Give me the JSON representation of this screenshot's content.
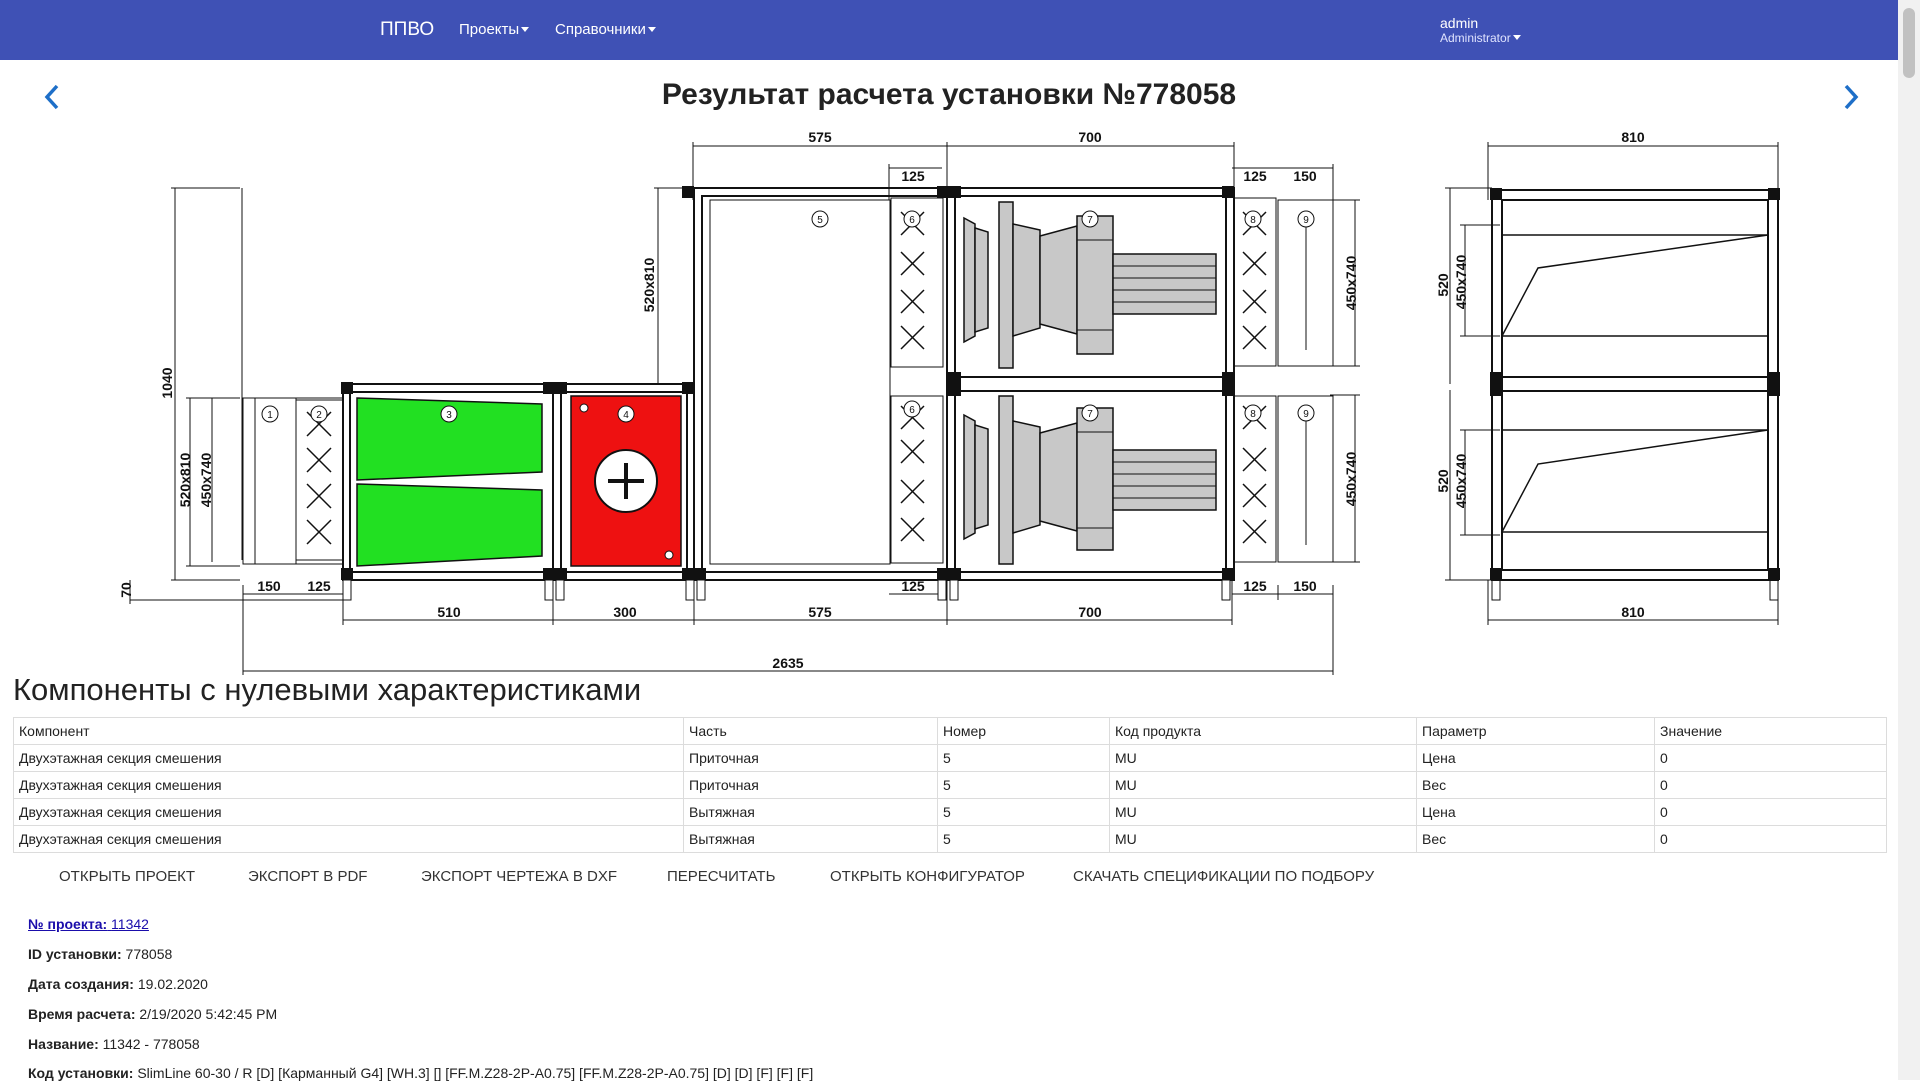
{
  "navbar": {
    "brand": "ППВО",
    "projects": "Проекты",
    "references": "Справочники",
    "user_name": "admin",
    "user_role": "Administrator",
    "color": "#3f51b5"
  },
  "page": {
    "title": "Результат расчета установки №778058"
  },
  "drawing": {
    "dims": {
      "top_575": "575",
      "top_700": "700",
      "top_125a": "125",
      "top_125b": "125",
      "top_150": "150",
      "left_1040": "1040",
      "left_520x810_upper": "520x810",
      "left_520x810": "520x810",
      "left_450x740": "450x740",
      "right_450x740_top": "450x740",
      "right_450x740_bottom": "450x740",
      "b_70": "70",
      "b_150a": "150",
      "b_125a": "125",
      "b_125b": "125",
      "b_125c": "125",
      "b_150b": "150",
      "b_510": "510",
      "b_300": "300",
      "b_575": "575",
      "b_700": "700",
      "b_2635": "2635",
      "side_810_top": "810",
      "side_810_bottom": "810",
      "side_520a": "520",
      "side_450x740a": "450x740",
      "side_520b": "520",
      "side_450x740b": "450x740"
    },
    "callouts": [
      "1",
      "2",
      "3",
      "4",
      "5",
      "6",
      "6",
      "7",
      "7",
      "8",
      "8",
      "9",
      "9"
    ],
    "colors": {
      "filter": "#22e022",
      "heater": "#ee1111",
      "fan": "#c8c8c8"
    }
  },
  "components": {
    "heading": "Компоненты с нулевыми характеристиками",
    "columns": [
      "Компонент",
      "Часть",
      "Номер",
      "Код продукта",
      "Параметр",
      "Значение"
    ],
    "rows": [
      [
        "Двухэтажная секция смешения",
        "Приточная",
        "5",
        "MU",
        "Цена",
        "0"
      ],
      [
        "Двухэтажная секция смешения",
        "Приточная",
        "5",
        "MU",
        "Вес",
        "0"
      ],
      [
        "Двухэтажная секция смешения",
        "Вытяжная",
        "5",
        "MU",
        "Цена",
        "0"
      ],
      [
        "Двухэтажная секция смешения",
        "Вытяжная",
        "5",
        "MU",
        "Вес",
        "0"
      ]
    ]
  },
  "actions": {
    "open_project": "ОТКРЫТЬ ПРОЕКТ",
    "export_pdf": "ЭКСПОРТ В PDF",
    "export_dxf": "ЭКСПОРТ ЧЕРТЕЖА В DXF",
    "recalculate": "ПЕРЕСЧИТАТЬ",
    "open_configurator": "ОТКРЫТЬ КОНФИГУРАТОР",
    "download_specs": "СКАЧАТЬ СПЕЦИФИКАЦИИ ПО ПОДБОРУ"
  },
  "info": {
    "project_label": "№ проекта:",
    "project_value": "11342",
    "unit_id_label": "ID установки:",
    "unit_id_value": "778058",
    "created_label": "Дата создания:",
    "created_value": "19.02.2020",
    "calc_time_label": "Время расчета:",
    "calc_time_value": "2/19/2020 5:42:45 PM",
    "name_label": "Название:",
    "name_value": "11342 - 778058",
    "code_label": "Код установки:",
    "code_value": "SlimLine 60-30 / R [D] [Карманный G4] [WH.3] [] [FF.M.Z28-2P-A0.75] [FF.M.Z28-2P-A0.75] [D] [D] [F] [F] [F]"
  }
}
